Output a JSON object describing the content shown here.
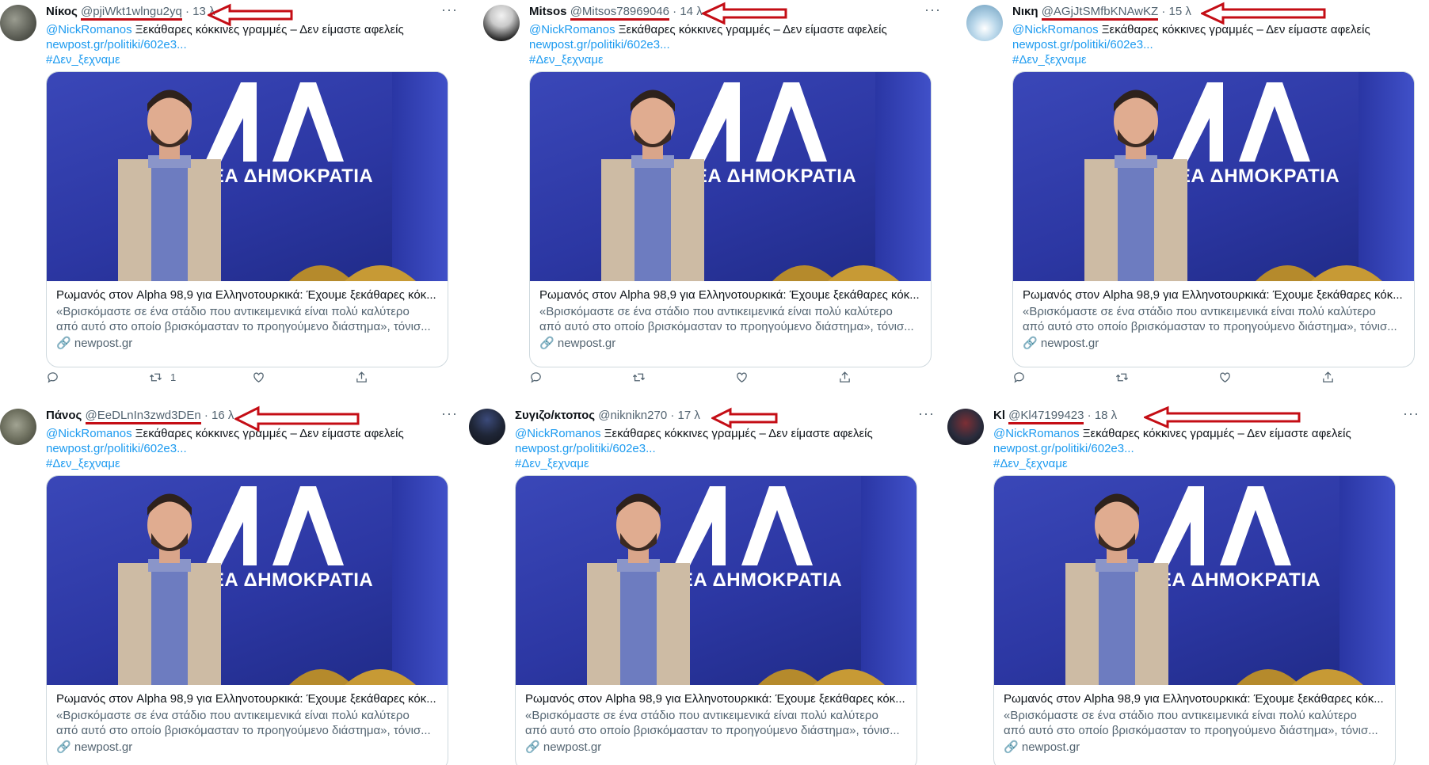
{
  "tweets": [
    {
      "name": "Νίκος",
      "handle": "@pjiWkt1wlngu2yq",
      "dot": "·",
      "time": "13 λ",
      "more": "···",
      "mention": "@NickRomanos",
      "text": " Ξεκάθαρες κόκκινες γραμμές – Δεν είμαστε αφελείς",
      "link": "newpost.gr/politiki/602e3...",
      "hashtag": "#Δεν_ξεχναμε",
      "party_logo": "ΝΔ",
      "party_name": "ΝΕΑ ΔΗΜΟΚΡΑΤΙΑ",
      "card_title": "Ρωμανός στον Alpha 98,9 για Ελληνοτουρκικά: Έχουμε ξεκάθαρες κόκ...",
      "card_desc_1": "«Βρισκόμαστε σε ένα στάδιο που αντικειμενικά είναι πολύ καλύτερο",
      "card_desc_2": "από αυτό στο οποίο βρισκόμασταν το προηγούμενο διάστημα», τόνισ...",
      "card_domain": "newpost.gr",
      "retweets": "1",
      "avatar": "avatar-photo"
    },
    {
      "name": "Mitsos",
      "handle": "@Mitsos78969046",
      "dot": "·",
      "time": "14 λ",
      "more": "···",
      "mention": "@NickRomanos",
      "text": " Ξεκάθαρες κόκκινες γραμμές – Δεν είμαστε αφελείς",
      "link": "newpost.gr/politiki/602e3...",
      "hashtag": "#Δεν_ξεχναμε",
      "party_logo": "ΝΔ",
      "party_name": "ΝΕΑ ΔΗΜΟΚΡΑΤΙΑ",
      "card_title": "Ρωμανός στον Alpha 98,9 για Ελληνοτουρκικά: Έχουμε ξεκάθαρες κόκ...",
      "card_desc_1": "«Βρισκόμαστε σε ένα στάδιο που αντικειμενικά είναι πολύ καλύτερο",
      "card_desc_2": "από αυτό στο οποίο βρισκόμασταν το προηγούμενο διάστημα», τόνισ...",
      "card_domain": "newpost.gr",
      "retweets": "",
      "avatar": "avatar-photo"
    },
    {
      "name": "Νικη",
      "handle": "@AGjJtSMfbKNAwKZ",
      "dot": "·",
      "time": "15 λ",
      "more": "",
      "mention": "@NickRomanos",
      "text": " Ξεκάθαρες κόκκινες γραμμές – Δεν είμαστε αφελείς",
      "link": "newpost.gr/politiki/602e3...",
      "hashtag": "#Δεν_ξεχναμε",
      "party_logo": "ΝΔ",
      "party_name": "ΝΕΑ ΔΗΜΟΚΡΑΤΙΑ",
      "card_title": "Ρωμανός στον Alpha 98,9 για Ελληνοτουρκικά: Έχουμε ξεκάθαρες κόκ...",
      "card_desc_1": "«Βρισκόμαστε σε ένα στάδιο που αντικειμενικά είναι πολύ καλύτερο",
      "card_desc_2": "από αυτό στο οποίο βρισκόμασταν το προηγούμενο διάστημα», τόνισ...",
      "card_domain": "newpost.gr",
      "retweets": "",
      "avatar": "avatar-photo"
    },
    {
      "name": "Πάνος",
      "handle": "@EeDLnIn3zwd3DEn",
      "dot": "·",
      "time": "16 λ",
      "more": "···",
      "mention": "@NickRomanos",
      "text": " Ξεκάθαρες κόκκινες γραμμές – Δεν είμαστε αφελείς",
      "link": "newpost.gr/politiki/602e3...",
      "hashtag": "#Δεν_ξεχναμε",
      "party_logo": "ΝΔ",
      "party_name": "ΝΕΑ ΔΗΜΟΚΡΑΤΙΑ",
      "card_title": "Ρωμανός στον Alpha 98,9 για Ελληνοτουρκικά: Έχουμε ξεκάθαρες κόκ...",
      "card_desc_1": "«Βρισκόμαστε σε ένα στάδιο που αντικειμενικά είναι πολύ καλύτερο",
      "card_desc_2": "από αυτό στο οποίο βρισκόμασταν το προηγούμενο διάστημα», τόνισ...",
      "card_domain": "newpost.gr",
      "retweets": "",
      "avatar": "avatar-photo"
    },
    {
      "name": "Συγιζο/κτοπος",
      "handle": "@niknikn270",
      "dot": "·",
      "time": "17 λ",
      "more": "···",
      "mention": "@NickRomanos",
      "text": " Ξεκάθαρες κόκκινες γραμμές – Δεν είμαστε αφελείς",
      "link": "newpost.gr/politiki/602e3...",
      "hashtag": "#Δεν_ξεχναμε",
      "party_logo": "ΝΔ",
      "party_name": "ΝΕΑ ΔΗΜΟΚΡΑΤΙΑ",
      "card_title": "Ρωμανός στον Alpha 98,9 για Ελληνοτουρκικά: Έχουμε ξεκάθαρες κόκ...",
      "card_desc_1": "«Βρισκόμαστε σε ένα στάδιο που αντικειμενικά είναι πολύ καλύτερο",
      "card_desc_2": "από αυτό στο οποίο βρισκόμασταν το προηγούμενο διάστημα», τόνισ...",
      "card_domain": "newpost.gr",
      "retweets": "",
      "avatar": "avatar-photo"
    },
    {
      "name": "Kl",
      "handle": "@Kl47199423",
      "dot": "·",
      "time": "18 λ",
      "more": "···",
      "mention": "@NickRomanos",
      "text": " Ξεκάθαρες κόκκινες γραμμές – Δεν είμαστε αφελείς",
      "link": "newpost.gr/politiki/602e3...",
      "hashtag": "#Δεν_ξεχναμε",
      "party_logo": "ΝΔ",
      "party_name": "ΝΕΑ ΔΗΜΟΚΡΑΤΙΑ",
      "card_title": "Ρωμανός στον Alpha 98,9 για Ελληνοτουρκικά: Έχουμε ξεκάθαρες κόκ...",
      "card_desc_1": "«Βρισκόμαστε σε ένα στάδιο που αντικειμενικά είναι πολύ καλύτερο",
      "card_desc_2": "από αυτό στο οποίο βρισκόμασταν το προηγούμενο διάστημα», τόνισ...",
      "card_domain": "newpost.gr",
      "retweets": "",
      "avatar": "avatar-photo"
    }
  ],
  "icons": {
    "reply": "reply-icon",
    "retweet": "retweet-icon",
    "like": "like-icon",
    "share": "share-icon",
    "link": "link-icon",
    "annotation": "red-arrow-icon"
  },
  "colors": {
    "accent": "#1d9bf0",
    "annotation": "#c40d15",
    "secondary_text": "#536471",
    "nd_blue": "#2c37a3"
  }
}
